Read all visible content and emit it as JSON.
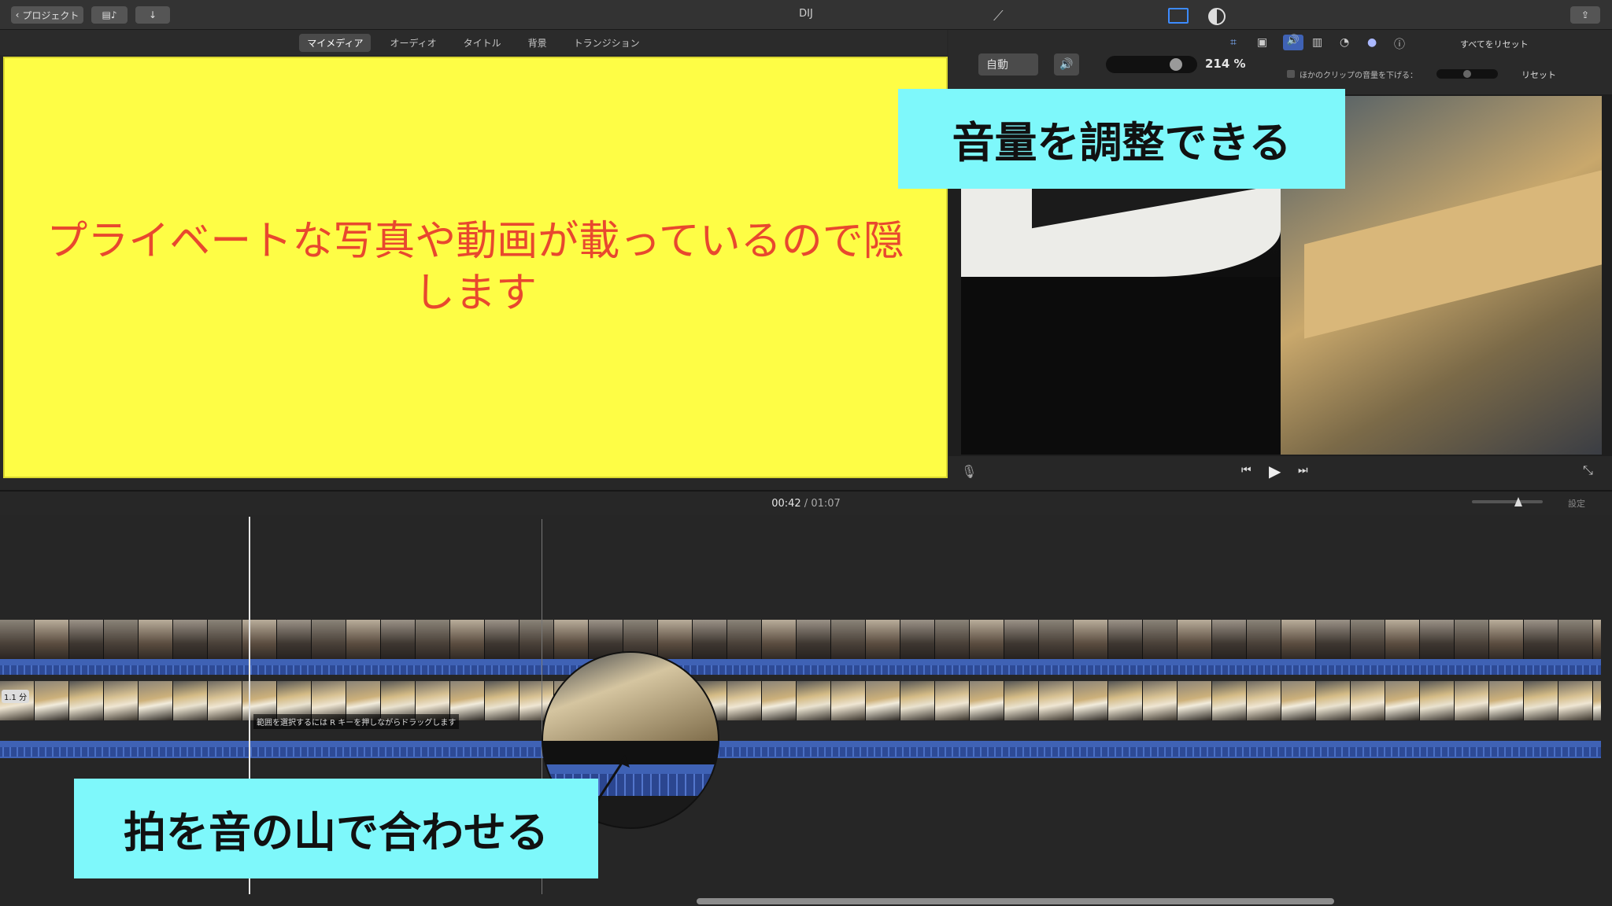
{
  "titlebar": {
    "back_label": "プロジェクト",
    "title": "DIJ"
  },
  "browser": {
    "tabs": [
      {
        "label": "マイメディア",
        "active": true
      },
      {
        "label": "オーディオ",
        "active": false
      },
      {
        "label": "タイトル",
        "active": false
      },
      {
        "label": "背景",
        "active": false
      },
      {
        "label": "トランジション",
        "active": false
      }
    ]
  },
  "privacy_cover": {
    "text": "プライベートな写真や動画が載っているので隠します"
  },
  "inspector": {
    "auto_label": "自動",
    "volume_percent": "214 %",
    "volume_level": 0.83,
    "reset_all_label": "すべてをリセット",
    "lower_others_label": "ほかのクリップの音量を下げる：",
    "reset_label": "リセット"
  },
  "callouts": {
    "volume": "音量を調整できる",
    "beat": "拍を音の山で合わせる"
  },
  "timeline": {
    "current_time": "00:42",
    "separator": "/",
    "total_time": "01:07",
    "settings_label": "設定",
    "clip_duration_badge": "1.1 分",
    "range_hint": "範囲を選択するには R キーを押しながらドラッグします"
  },
  "colors": {
    "accent": "#3f62b5",
    "callout": "#7ef8fb",
    "cover": "#fefd45",
    "cover_text": "#e8482e"
  }
}
